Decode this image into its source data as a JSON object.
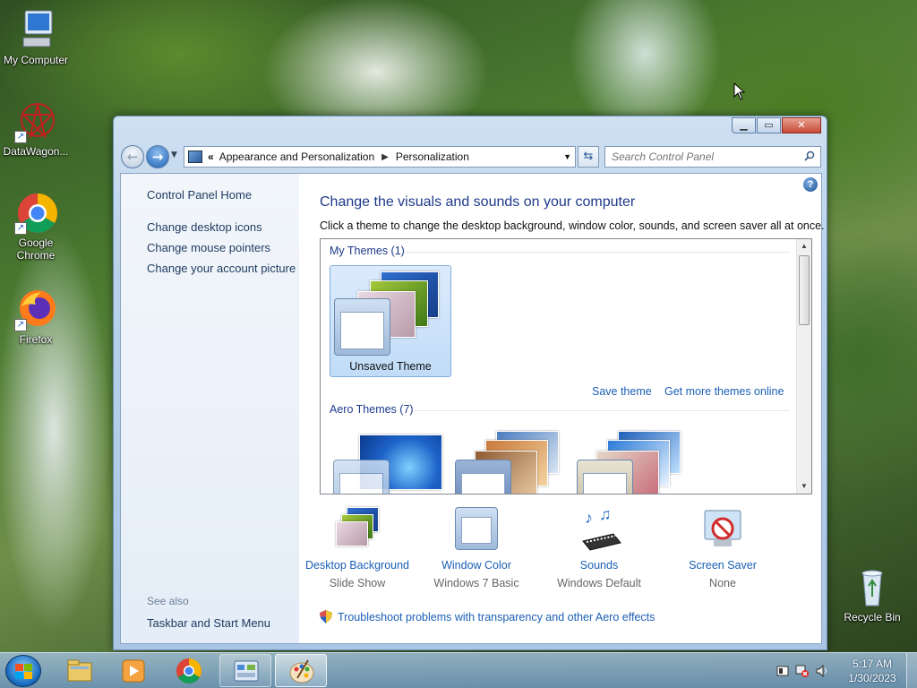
{
  "desktop": {
    "icons": [
      {
        "label": "My Computer"
      },
      {
        "label": "DataWagon..."
      },
      {
        "label": "Google Chrome"
      },
      {
        "label": "Firefox"
      },
      {
        "label": "Recycle Bin"
      }
    ]
  },
  "window": {
    "controls": {
      "minimize": "▁",
      "maximize": "▭",
      "close": "✕"
    },
    "address": {
      "chevrons": "«",
      "crumbs": [
        "Appearance and Personalization",
        "Personalization"
      ]
    },
    "search": {
      "placeholder": "Search Control Panel"
    },
    "left": {
      "home": "Control Panel Home",
      "links": [
        "Change desktop icons",
        "Change mouse pointers",
        "Change your account picture"
      ],
      "see_also": "See also",
      "see_also_links": [
        "Taskbar and Start Menu"
      ]
    },
    "main": {
      "heading": "Change the visuals and sounds on your computer",
      "subtext": "Click a theme to change the desktop background, window color, sounds, and screen saver all at once.",
      "my_themes_header": "My Themes (1)",
      "unsaved_theme": "Unsaved Theme",
      "save_theme": "Save theme",
      "get_more": "Get more themes online",
      "aero_header": "Aero Themes (7)",
      "bottom": [
        {
          "label": "Desktop Background",
          "value": "Slide Show"
        },
        {
          "label": "Window Color",
          "value": "Windows 7 Basic"
        },
        {
          "label": "Sounds",
          "value": "Windows Default"
        },
        {
          "label": "Screen Saver",
          "value": "None"
        }
      ],
      "troubleshoot": "Troubleshoot problems with transparency and other Aero effects"
    }
  },
  "taskbar": {
    "time": "5:17 AM",
    "date": "1/30/2023"
  }
}
